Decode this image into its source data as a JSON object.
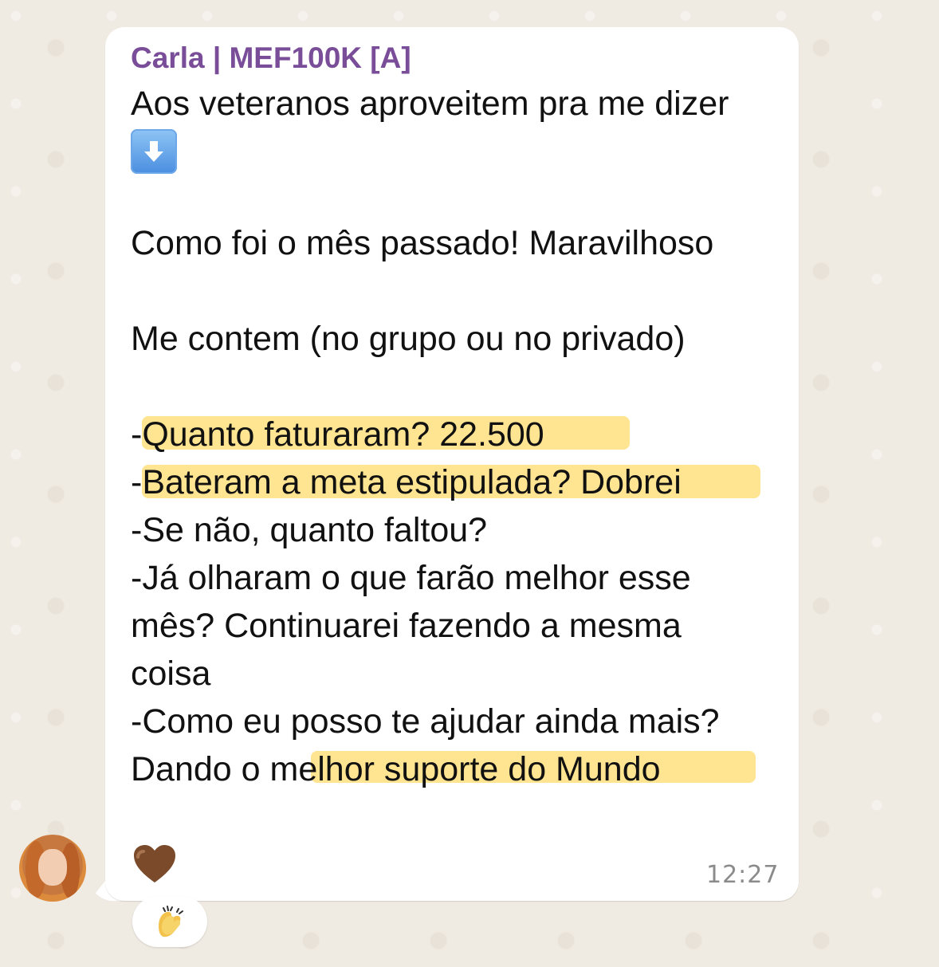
{
  "message": {
    "sender": "Carla | MEF100K [A]",
    "lines": [
      "Aos veteranos aproveitem pra me dizer",
      "Como foi o mês passado! Maravilhoso",
      "Me contem (no grupo ou no privado)",
      "-Quanto faturaram? 22.500",
      "-Bateram a meta estipulada? Dobrei",
      "-Se não, quanto faltou?",
      "-Já olharam o que farão melhor esse",
      "mês? Continuarei fazendo a mesma",
      "coisa",
      "-Como eu posso te ajudar ainda mais?",
      "Dando o melhor suporte do Mundo"
    ],
    "time": "12:27",
    "emoji_arrow": "down-arrow-emoji",
    "emoji_heart": "brown-heart-emoji",
    "reaction": "clapping-hands-emoji"
  },
  "colors": {
    "sender": "#7a4d99",
    "highlight": "#ffd54f",
    "bubble": "#ffffff",
    "background": "#efeae2",
    "timestamp": "#8b8b8b"
  },
  "avatar": {
    "icon": "contact-avatar"
  }
}
